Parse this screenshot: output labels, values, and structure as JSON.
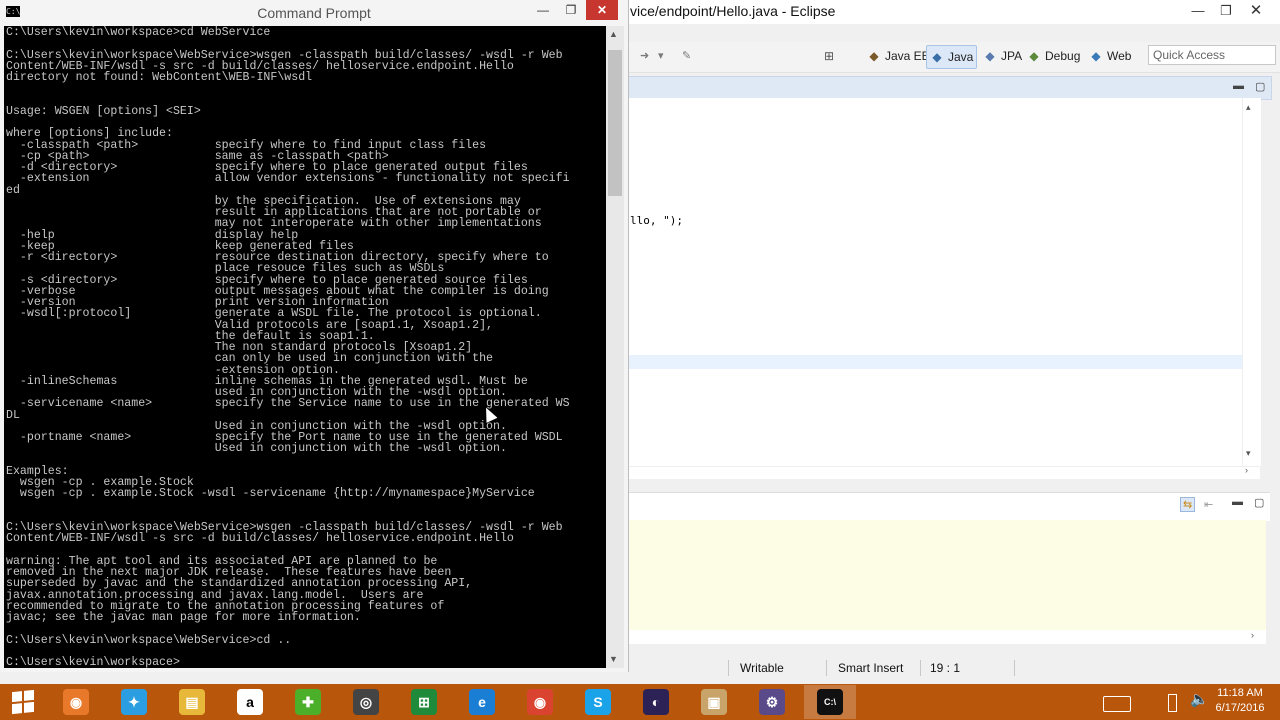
{
  "eclipse": {
    "title": "vice/endpoint/Hello.java - Eclipse",
    "perspectives": [
      {
        "label": "Java EE",
        "icon": "java-ee-icon"
      },
      {
        "label": "Java",
        "icon": "java-icon"
      },
      {
        "label": "JPA",
        "icon": "jpa-icon"
      },
      {
        "label": "Debug",
        "icon": "debug-icon"
      },
      {
        "label": "Web",
        "icon": "web-icon"
      }
    ],
    "active_perspective": "Java",
    "quick_access_placeholder": "Quick Access",
    "code_fragment": "llo, \");",
    "status": {
      "writable": "Writable",
      "insert_mode": "Smart Insert",
      "position": "19 : 1"
    }
  },
  "cmd": {
    "title": "Command Prompt",
    "lines": [
      "C:\\Users\\kevin\\workspace>cd WebService",
      "",
      "C:\\Users\\kevin\\workspace\\WebService>wsgen -classpath build/classes/ -wsdl -r Web",
      "Content/WEB-INF/wsdl -s src -d build/classes/ helloservice.endpoint.Hello",
      "directory not found: WebContent\\WEB-INF\\wsdl",
      "",
      "",
      "Usage: WSGEN [options] <SEI>",
      "",
      "where [options] include:",
      "  -classpath <path>           specify where to find input class files",
      "  -cp <path>                  same as -classpath <path>",
      "  -d <directory>              specify where to place generated output files",
      "  -extension                  allow vendor extensions - functionality not specifi",
      "ed",
      "                              by the specification.  Use of extensions may",
      "                              result in applications that are not portable or",
      "                              may not interoperate with other implementations",
      "  -help                       display help",
      "  -keep                       keep generated files",
      "  -r <directory>              resource destination directory, specify where to",
      "                              place resouce files such as WSDLs",
      "  -s <directory>              specify where to place generated source files",
      "  -verbose                    output messages about what the compiler is doing",
      "  -version                    print version information",
      "  -wsdl[:protocol]            generate a WSDL file. The protocol is optional.",
      "                              Valid protocols are [soap1.1, Xsoap1.2],",
      "                              the default is soap1.1.",
      "                              The non standard protocols [Xsoap1.2]",
      "                              can only be used in conjunction with the",
      "                              -extension option.",
      "  -inlineSchemas              inline schemas in the generated wsdl. Must be",
      "                              used in conjunction with the -wsdl option.",
      "  -servicename <name>         specify the Service name to use in the generated WS",
      "DL",
      "                              Used in conjunction with the -wsdl option.",
      "  -portname <name>            specify the Port name to use in the generated WSDL",
      "                              Used in conjunction with the -wsdl option.",
      "",
      "Examples:",
      "  wsgen -cp . example.Stock",
      "  wsgen -cp . example.Stock -wsdl -servicename {http://mynamespace}MyService",
      "",
      "",
      "C:\\Users\\kevin\\workspace\\WebService>wsgen -classpath build/classes/ -wsdl -r Web",
      "Content/WEB-INF/wsdl -s src -d build/classes/ helloservice.endpoint.Hello",
      "",
      "warning: The apt tool and its associated API are planned to be",
      "removed in the next major JDK release.  These features have been",
      "superseded by javac and the standardized annotation processing API,",
      "javax.annotation.processing and javax.lang.model.  Users are",
      "recommended to migrate to the annotation processing features of",
      "javac; see the javac man page for more information.",
      "",
      "C:\\Users\\kevin\\workspace\\WebService>cd ..",
      "",
      "C:\\Users\\kevin\\workspace>"
    ]
  },
  "taskbar": {
    "apps": [
      {
        "name": "app-1",
        "icon": "firefox-icon",
        "color": "#e8792a",
        "glyph": "◉",
        "active": false
      },
      {
        "name": "app-2",
        "icon": "bird-icon",
        "color": "#2a9ee0",
        "glyph": "✦",
        "active": false
      },
      {
        "name": "app-3",
        "icon": "file-explorer-icon",
        "color": "#e8b83a",
        "glyph": "▤",
        "active": false
      },
      {
        "name": "app-4",
        "icon": "amazon-icon",
        "color": "#ffffff",
        "glyph": "a",
        "active": false
      },
      {
        "name": "app-5",
        "icon": "plus-app-icon",
        "color": "#4caf2a",
        "glyph": "✚",
        "active": false
      },
      {
        "name": "app-6",
        "icon": "media-player-icon",
        "color": "#444444",
        "glyph": "◎",
        "active": false
      },
      {
        "name": "app-7",
        "icon": "spreadsheet-icon",
        "color": "#1f8a3a",
        "glyph": "⊞",
        "active": false
      },
      {
        "name": "app-8",
        "icon": "internet-explorer-icon",
        "color": "#1a7fd4",
        "glyph": "e",
        "active": false
      },
      {
        "name": "app-9",
        "icon": "chrome-icon",
        "color": "#d9432f",
        "glyph": "◉",
        "active": false
      },
      {
        "name": "app-10",
        "icon": "skype-icon",
        "color": "#1aa3e8",
        "glyph": "S",
        "active": false
      },
      {
        "name": "app-11",
        "icon": "eclipse-icon",
        "color": "#2c2255",
        "glyph": "◐",
        "active": false
      },
      {
        "name": "app-12",
        "icon": "archive-icon",
        "color": "#c9a46a",
        "glyph": "▣",
        "active": false
      },
      {
        "name": "app-13",
        "icon": "tool-icon",
        "color": "#5a4a8a",
        "glyph": "⚙",
        "active": false
      },
      {
        "name": "app-14",
        "icon": "command-prompt-icon",
        "color": "#111111",
        "glyph": "C:\\",
        "active": true
      }
    ],
    "clock_time": "11:18 AM",
    "clock_date": "6/17/2016"
  }
}
